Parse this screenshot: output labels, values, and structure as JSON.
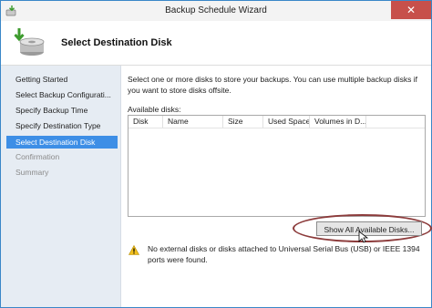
{
  "window": {
    "title": "Backup Schedule Wizard",
    "close_glyph": "✕"
  },
  "header": {
    "title": "Select Destination Disk"
  },
  "sidebar": {
    "items": [
      {
        "label": "Getting Started",
        "state": "normal"
      },
      {
        "label": "Select Backup Configurati...",
        "state": "normal"
      },
      {
        "label": "Specify Backup Time",
        "state": "normal"
      },
      {
        "label": "Specify Destination Type",
        "state": "normal"
      },
      {
        "label": "Select Destination Disk",
        "state": "active"
      },
      {
        "label": "Confirmation",
        "state": "disabled"
      },
      {
        "label": "Summary",
        "state": "disabled"
      }
    ]
  },
  "main": {
    "intro": "Select one or more disks to store your backups. You can use multiple backup disks if you want to store disks offsite.",
    "available_label": "Available disks:",
    "columns": [
      "Disk",
      "Name",
      "Size",
      "Used Space",
      "Volumes in D..."
    ],
    "show_all_button": "Show All Available Disks...",
    "warning": "No external disks or disks attached to Universal Serial Bus (USB) or IEEE 1394 ports were found."
  },
  "colors": {
    "active_item": "#3d8ee6",
    "sidebar_bg": "#e6ecf3",
    "close_button": "#c7504b",
    "annotation_ellipse": "#8c3b3b"
  }
}
